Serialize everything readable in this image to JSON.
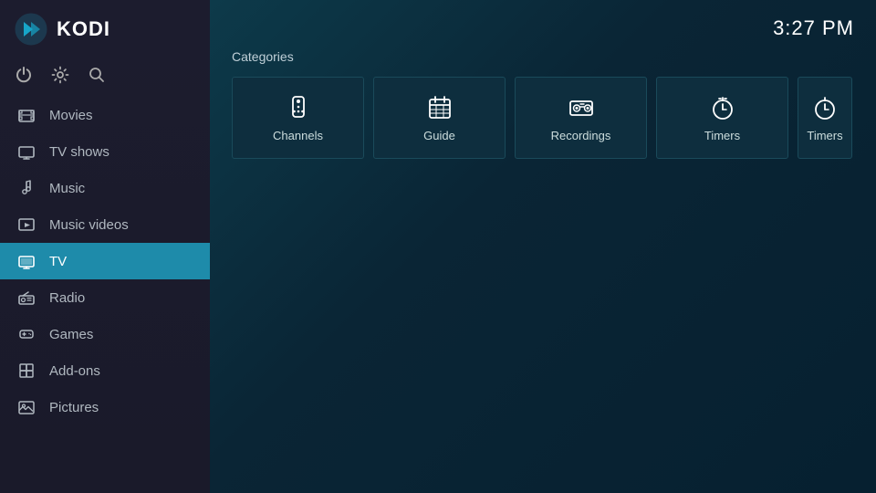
{
  "sidebar": {
    "app_name": "KODI",
    "nav_items": [
      {
        "id": "movies",
        "label": "Movies",
        "icon": "movies",
        "active": false
      },
      {
        "id": "tvshows",
        "label": "TV shows",
        "icon": "tvshows",
        "active": false
      },
      {
        "id": "music",
        "label": "Music",
        "icon": "music",
        "active": false
      },
      {
        "id": "musicvideos",
        "label": "Music videos",
        "icon": "musicvideos",
        "active": false
      },
      {
        "id": "tv",
        "label": "TV",
        "icon": "tv",
        "active": true
      },
      {
        "id": "radio",
        "label": "Radio",
        "icon": "radio",
        "active": false
      },
      {
        "id": "games",
        "label": "Games",
        "icon": "games",
        "active": false
      },
      {
        "id": "addons",
        "label": "Add-ons",
        "icon": "addons",
        "active": false
      },
      {
        "id": "pictures",
        "label": "Pictures",
        "icon": "pictures",
        "active": false
      }
    ]
  },
  "topbar": {
    "clock": "3:27 PM"
  },
  "main": {
    "categories_label": "Categories",
    "cards": [
      {
        "id": "channels",
        "label": "Channels"
      },
      {
        "id": "guide",
        "label": "Guide"
      },
      {
        "id": "recordings",
        "label": "Recordings"
      },
      {
        "id": "timers",
        "label": "Timers"
      },
      {
        "id": "timers2",
        "label": "Timers"
      }
    ]
  }
}
